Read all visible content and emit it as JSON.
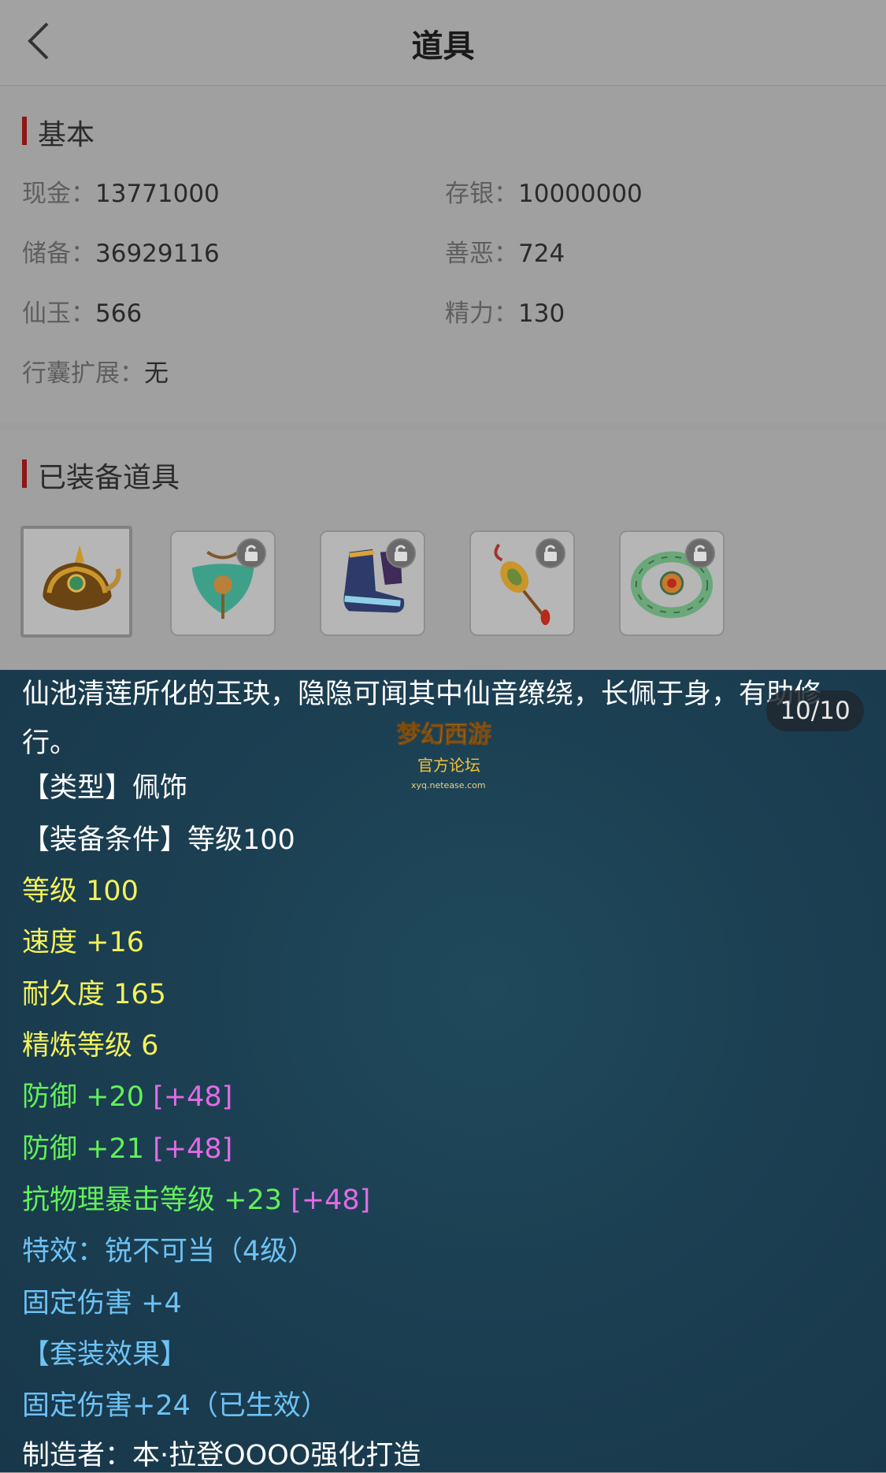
{
  "header": {
    "title": "道具"
  },
  "basic": {
    "section_title": "基本",
    "fields": [
      {
        "label": "现金：",
        "value": "13771000"
      },
      {
        "label": "存银：",
        "value": "10000000"
      },
      {
        "label": "储备：",
        "value": "36929116"
      },
      {
        "label": "善恶：",
        "value": "724"
      },
      {
        "label": "仙玉：",
        "value": "566"
      },
      {
        "label": "精力：",
        "value": "130"
      },
      {
        "label": "行囊扩展：",
        "value": "无"
      }
    ]
  },
  "equipped": {
    "section_title": "已装备道具",
    "items": [
      {
        "name": "helmet-item",
        "locked": false,
        "selected": true
      },
      {
        "name": "necklace-item",
        "locked": true
      },
      {
        "name": "boots-item",
        "locked": true
      },
      {
        "name": "pendant-item",
        "locked": true
      },
      {
        "name": "bracelet-item",
        "locked": true
      }
    ]
  },
  "detail": {
    "description": "仙池清莲所化的玉玦，隐隐可闻其中仙音缭绕，长佩于身，有助修行。",
    "pager": "10/10",
    "logo_text": "梦幻西游",
    "logo_sub": "官方论坛",
    "logo_url": "xyq.netease.com",
    "type_line": "【类型】佩饰",
    "require_line": "【装备条件】等级100",
    "level": "等级 100",
    "speed": "速度 +16",
    "durability": "耐久度 165",
    "refine": "精炼等级 6",
    "def1_base": "防御 +20",
    "def1_bonus": "[+48]",
    "def2_base": "防御 +21",
    "def2_bonus": "[+48]",
    "crit_base": "抗物理暴击等级 +23",
    "crit_bonus": "[+48]",
    "effect": "特效：锐不可当（4级）",
    "fixed_dmg": "固定伤害 +4",
    "set_title": "【套装效果】",
    "set_effect": "固定伤害+24（已生效）",
    "maker": "制造者：本·拉登OOOO强化打造"
  }
}
